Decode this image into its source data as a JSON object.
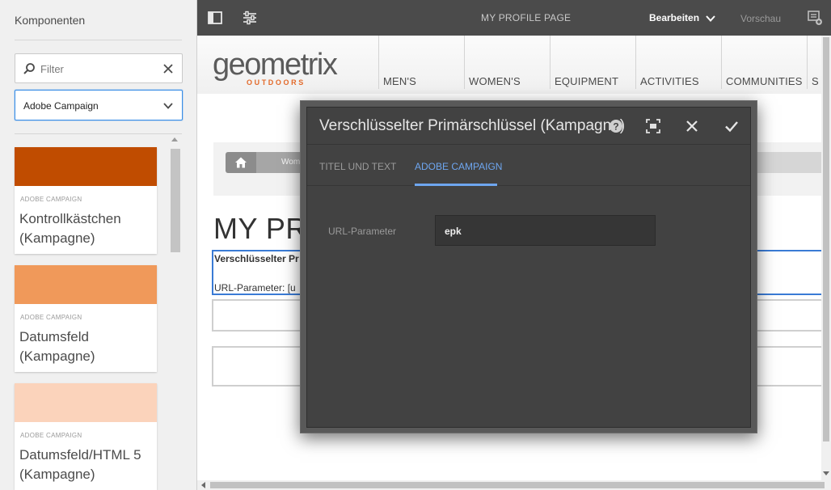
{
  "sidebar": {
    "title": "Komponenten",
    "filter": {
      "placeholder": "Filter"
    },
    "group_select": {
      "value": "Adobe Campaign"
    },
    "components": [
      {
        "category": "ADOBE CAMPAIGN",
        "name": "Kontrollkästchen\n(Kampagne)",
        "color": "#c04c00"
      },
      {
        "category": "ADOBE CAMPAIGN",
        "name": "Datumsfeld\n(Kampagne)",
        "color": "#f0995a"
      },
      {
        "category": "ADOBE CAMPAIGN",
        "name": "Datumsfeld/HTML 5\n(Kampagne)",
        "color": "#fbd3bb"
      }
    ]
  },
  "toolbar": {
    "page_title": "MY PROFILE PAGE",
    "mode": "Bearbeiten",
    "preview": "Vorschau",
    "icons": [
      "sidebar-toggle-icon",
      "page-properties-icon",
      "annotations-icon"
    ]
  },
  "site": {
    "logo": "geometrix",
    "logo_sub": "OUTDOORS",
    "nav": [
      "MEN'S",
      "WOMEN'S",
      "EQUIPMENT",
      "ACTIVITIES",
      "COMMUNITIES",
      "S"
    ],
    "breadcrumb": [
      "Women's"
    ],
    "heading": "MY PR",
    "component_title": "Verschlüsselter Pr",
    "component_param": "URL-Parameter: [u"
  },
  "dialog": {
    "title": "Verschlüsselter Primärschlüssel (Kampagne)",
    "tabs": [
      "TITEL UND TEXT",
      "ADOBE CAMPAIGN"
    ],
    "active_tab": "ADOBE CAMPAIGN",
    "field_label": "URL-Parameter",
    "field_value": "epk",
    "accent_color": "#6ea6f0"
  }
}
